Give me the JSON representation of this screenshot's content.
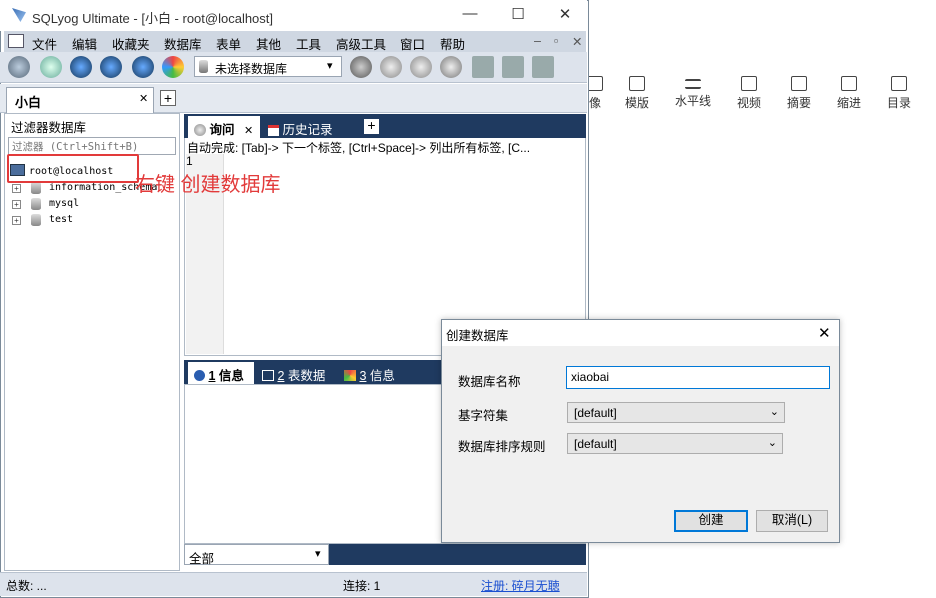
{
  "background": {
    "toolbar_items": [
      {
        "label": "像",
        "icon": "image-icon"
      },
      {
        "label": "模版",
        "icon": "template-icon"
      },
      {
        "label": "水平线",
        "icon": "horizontal-line-icon"
      },
      {
        "label": "视频",
        "icon": "video-icon"
      },
      {
        "label": "摘要",
        "icon": "summary-icon"
      },
      {
        "label": "缩进",
        "icon": "indent-icon"
      },
      {
        "label": "目录",
        "icon": "toc-icon"
      }
    ]
  },
  "window": {
    "title": "SQLyog Ultimate - [小白 - root@localhost]",
    "minimize": "—",
    "maximize": "☐",
    "close": "✕"
  },
  "menu": [
    "文件",
    "编辑",
    "收藏夹",
    "数据库",
    "表单",
    "其他",
    "工具",
    "高级工具",
    "窗口",
    "帮助"
  ],
  "toolbar": {
    "db_select": "未选择数据库"
  },
  "connection_tab": {
    "label": "小白",
    "close": "✕",
    "add": "+"
  },
  "left_panel": {
    "header": "过滤器数据库",
    "filter_placeholder": "过滤器 (Ctrl+Shift+B)",
    "root": "root@localhost",
    "databases": [
      "information_schema",
      "mysql",
      "test"
    ]
  },
  "query": {
    "tabs": [
      "询问",
      "历史记录"
    ],
    "tab_close": "✕",
    "add": "+",
    "autocomplete_hint": "自动完成: [Tab]-> 下一个标签, [Ctrl+Space]-> 列出所有标签, [C...",
    "line_number": "1"
  },
  "results": {
    "tabs": [
      {
        "num": "1",
        "label": "信息"
      },
      {
        "num": "2",
        "label": "表数据"
      },
      {
        "num": "3",
        "label": "信息"
      }
    ],
    "filter_value": "全部"
  },
  "status": {
    "total": "总数: ...",
    "connections": "连接: 1",
    "register": "注册:  碎月无聴"
  },
  "annotation": "右键  创建数据库",
  "dialog": {
    "title": "创建数据库",
    "close": "✕",
    "name_label": "数据库名称",
    "name_value": "xiaobai",
    "charset_label": "基字符集",
    "charset_value": "[default]",
    "collation_label": "数据库排序规则",
    "collation_value": "[default]",
    "create_button": "创建",
    "cancel_button": "取消(L)"
  },
  "colors": {
    "accent_red": "#e23a3a",
    "tab_bar": "#1f3a60",
    "menu_bg": "#cfd7e2"
  }
}
